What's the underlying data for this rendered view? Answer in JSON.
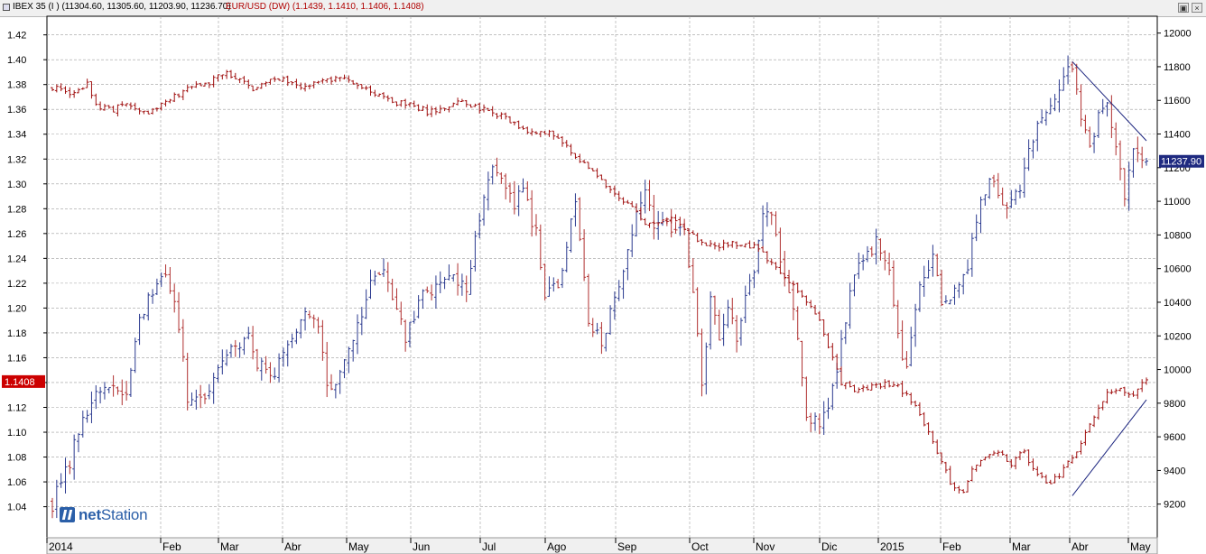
{
  "window": {
    "title_ibex": "IBEX 35 (I ) (11304.60, 11305.60, 11203.90, 11236.70)",
    "title_eurusd": "EUR/USD (DW) (1.1439, 1.1410, 1.1406, 1.1408)"
  },
  "logo": {
    "text_bold": "net",
    "text_rest": "Station"
  },
  "chart_data": {
    "type": "bar",
    "subtype": "ohlc",
    "x_tick_labels": [
      "2014",
      "Feb",
      "Mar",
      "Abr",
      "May",
      "Jun",
      "Jul",
      "Ago",
      "Sep",
      "Oct",
      "Nov",
      "Dic",
      "2015",
      "Feb",
      "Mar",
      "Abr",
      "May"
    ],
    "y_left": {
      "ticks": [
        1.04,
        1.06,
        1.08,
        1.1,
        1.12,
        1.14,
        1.16,
        1.18,
        1.2,
        1.22,
        1.24,
        1.26,
        1.28,
        1.3,
        1.32,
        1.34,
        1.36,
        1.38,
        1.4,
        1.42
      ],
      "range": [
        1.015,
        1.435
      ],
      "last_value_label": "1.1408"
    },
    "y_right": {
      "ticks": [
        9200,
        9400,
        9600,
        9800,
        10000,
        10200,
        10400,
        10600,
        10800,
        11000,
        11200,
        11400,
        11600,
        11800,
        12000
      ],
      "range": [
        9000,
        12100
      ],
      "last_value_label": "11237.90"
    },
    "grid": true,
    "series": [
      {
        "name": "IBEX 35",
        "axis": "right",
        "key": [
          [
            0,
            9200
          ],
          [
            3,
            9380
          ],
          [
            7,
            9700
          ],
          [
            10,
            9830
          ],
          [
            13,
            9880
          ],
          [
            17,
            9860
          ],
          [
            20,
            10300
          ],
          [
            24,
            10550
          ],
          [
            26,
            10600
          ],
          [
            28,
            10400
          ],
          [
            31,
            9850
          ],
          [
            34,
            9800
          ],
          [
            38,
            10000
          ],
          [
            41,
            10150
          ],
          [
            45,
            10200
          ],
          [
            47,
            10050
          ],
          [
            50,
            9950
          ],
          [
            55,
            10180
          ],
          [
            58,
            10350
          ],
          [
            61,
            10300
          ],
          [
            63,
            9900
          ],
          [
            66,
            9950
          ],
          [
            70,
            10250
          ],
          [
            73,
            10500
          ],
          [
            76,
            10600
          ],
          [
            78,
            10400
          ],
          [
            81,
            10200
          ],
          [
            85,
            10450
          ],
          [
            88,
            10500
          ],
          [
            92,
            10550
          ],
          [
            95,
            10500
          ],
          [
            98,
            10900
          ],
          [
            101,
            11250
          ],
          [
            103,
            11100
          ],
          [
            106,
            11000
          ],
          [
            108,
            11050
          ],
          [
            111,
            10800
          ],
          [
            113,
            10450
          ],
          [
            116,
            10480
          ],
          [
            118,
            10700
          ],
          [
            120,
            11000
          ],
          [
            123,
            10300
          ],
          [
            126,
            10180
          ],
          [
            129,
            10400
          ],
          [
            132,
            10700
          ],
          [
            134,
            10950
          ],
          [
            136,
            11100
          ],
          [
            138,
            10850
          ],
          [
            141,
            10900
          ],
          [
            142,
            10850
          ],
          [
            145,
            10800
          ],
          [
            147,
            10500
          ],
          [
            149,
            9900
          ],
          [
            151,
            10400
          ],
          [
            153,
            10200
          ],
          [
            155,
            10400
          ],
          [
            157,
            10150
          ],
          [
            159,
            10400
          ],
          [
            161,
            10600
          ],
          [
            163,
            10950
          ],
          [
            165,
            10900
          ],
          [
            168,
            10550
          ],
          [
            171,
            10200
          ],
          [
            173,
            9700
          ],
          [
            176,
            9700
          ],
          [
            178,
            9800
          ],
          [
            180,
            10000
          ],
          [
            182,
            10300
          ],
          [
            184,
            10600
          ],
          [
            187,
            10700
          ],
          [
            189,
            10750
          ],
          [
            192,
            10550
          ],
          [
            194,
            10200
          ],
          [
            196,
            10000
          ],
          [
            199,
            10500
          ],
          [
            202,
            10650
          ],
          [
            204,
            10400
          ],
          [
            208,
            10500
          ],
          [
            210,
            10600
          ],
          [
            212,
            10900
          ],
          [
            215,
            11150
          ],
          [
            217,
            11050
          ],
          [
            219,
            10950
          ],
          [
            222,
            11050
          ],
          [
            224,
            11300
          ],
          [
            226,
            11450
          ],
          [
            228,
            11550
          ],
          [
            230,
            11600
          ],
          [
            232,
            11750
          ],
          [
            234,
            11780
          ],
          [
            236,
            11500
          ],
          [
            238,
            11350
          ],
          [
            240,
            11500
          ],
          [
            242,
            11550
          ],
          [
            244,
            11300
          ],
          [
            246,
            11050
          ],
          [
            248,
            11350
          ],
          [
            250,
            11240
          ]
        ]
      },
      {
        "name": "EUR/USD",
        "axis": "left",
        "key": [
          [
            0,
            1.378
          ],
          [
            4,
            1.372
          ],
          [
            8,
            1.38
          ],
          [
            10,
            1.362
          ],
          [
            14,
            1.36
          ],
          [
            17,
            1.365
          ],
          [
            19,
            1.362
          ],
          [
            22,
            1.356
          ],
          [
            25,
            1.365
          ],
          [
            29,
            1.372
          ],
          [
            32,
            1.378
          ],
          [
            36,
            1.382
          ],
          [
            40,
            1.39
          ],
          [
            44,
            1.382
          ],
          [
            46,
            1.376
          ],
          [
            50,
            1.385
          ],
          [
            54,
            1.383
          ],
          [
            58,
            1.378
          ],
          [
            62,
            1.382
          ],
          [
            66,
            1.385
          ],
          [
            69,
            1.38
          ],
          [
            72,
            1.375
          ],
          [
            75,
            1.37
          ],
          [
            79,
            1.365
          ],
          [
            82,
            1.365
          ],
          [
            86,
            1.358
          ],
          [
            89,
            1.36
          ],
          [
            93,
            1.365
          ],
          [
            96,
            1.364
          ],
          [
            100,
            1.358
          ],
          [
            103,
            1.355
          ],
          [
            107,
            1.345
          ],
          [
            111,
            1.34
          ],
          [
            114,
            1.34
          ],
          [
            118,
            1.33
          ],
          [
            121,
            1.32
          ],
          [
            124,
            1.312
          ],
          [
            127,
            1.3
          ],
          [
            130,
            1.29
          ],
          [
            133,
            1.282
          ],
          [
            136,
            1.268
          ],
          [
            139,
            1.27
          ],
          [
            142,
            1.272
          ],
          [
            145,
            1.262
          ],
          [
            148,
            1.255
          ],
          [
            152,
            1.248
          ],
          [
            155,
            1.252
          ],
          [
            158,
            1.25
          ],
          [
            161,
            1.25
          ],
          [
            164,
            1.24
          ],
          [
            167,
            1.228
          ],
          [
            170,
            1.22
          ],
          [
            173,
            1.205
          ],
          [
            176,
            1.19
          ],
          [
            178,
            1.17
          ],
          [
            181,
            1.14
          ],
          [
            184,
            1.135
          ],
          [
            187,
            1.135
          ],
          [
            190,
            1.138
          ],
          [
            193,
            1.14
          ],
          [
            196,
            1.13
          ],
          [
            199,
            1.115
          ],
          [
            203,
            1.085
          ],
          [
            206,
            1.06
          ],
          [
            209,
            1.05
          ],
          [
            211,
            1.07
          ],
          [
            214,
            1.08
          ],
          [
            217,
            1.085
          ],
          [
            220,
            1.075
          ],
          [
            223,
            1.085
          ],
          [
            225,
            1.07
          ],
          [
            228,
            1.058
          ],
          [
            231,
            1.065
          ],
          [
            235,
            1.085
          ],
          [
            238,
            1.105
          ],
          [
            240,
            1.118
          ],
          [
            242,
            1.13
          ],
          [
            245,
            1.135
          ],
          [
            248,
            1.128
          ],
          [
            250,
            1.14
          ]
        ]
      }
    ],
    "trendlines": [
      {
        "axis": "right",
        "from": [
          234,
          11830
        ],
        "to": [
          251,
          11360
        ]
      },
      {
        "axis": "right",
        "from": [
          234,
          9250
        ],
        "to": [
          251,
          9820
        ]
      }
    ],
    "colors": {
      "up": "#2b3a8f",
      "down": "#b03030",
      "eur_bar": "#a01010",
      "trendline": "#1a237e",
      "grid": "#9e9e9e",
      "left_label_bg": "#cc0000",
      "right_label_bg": "#1f2a80"
    }
  }
}
